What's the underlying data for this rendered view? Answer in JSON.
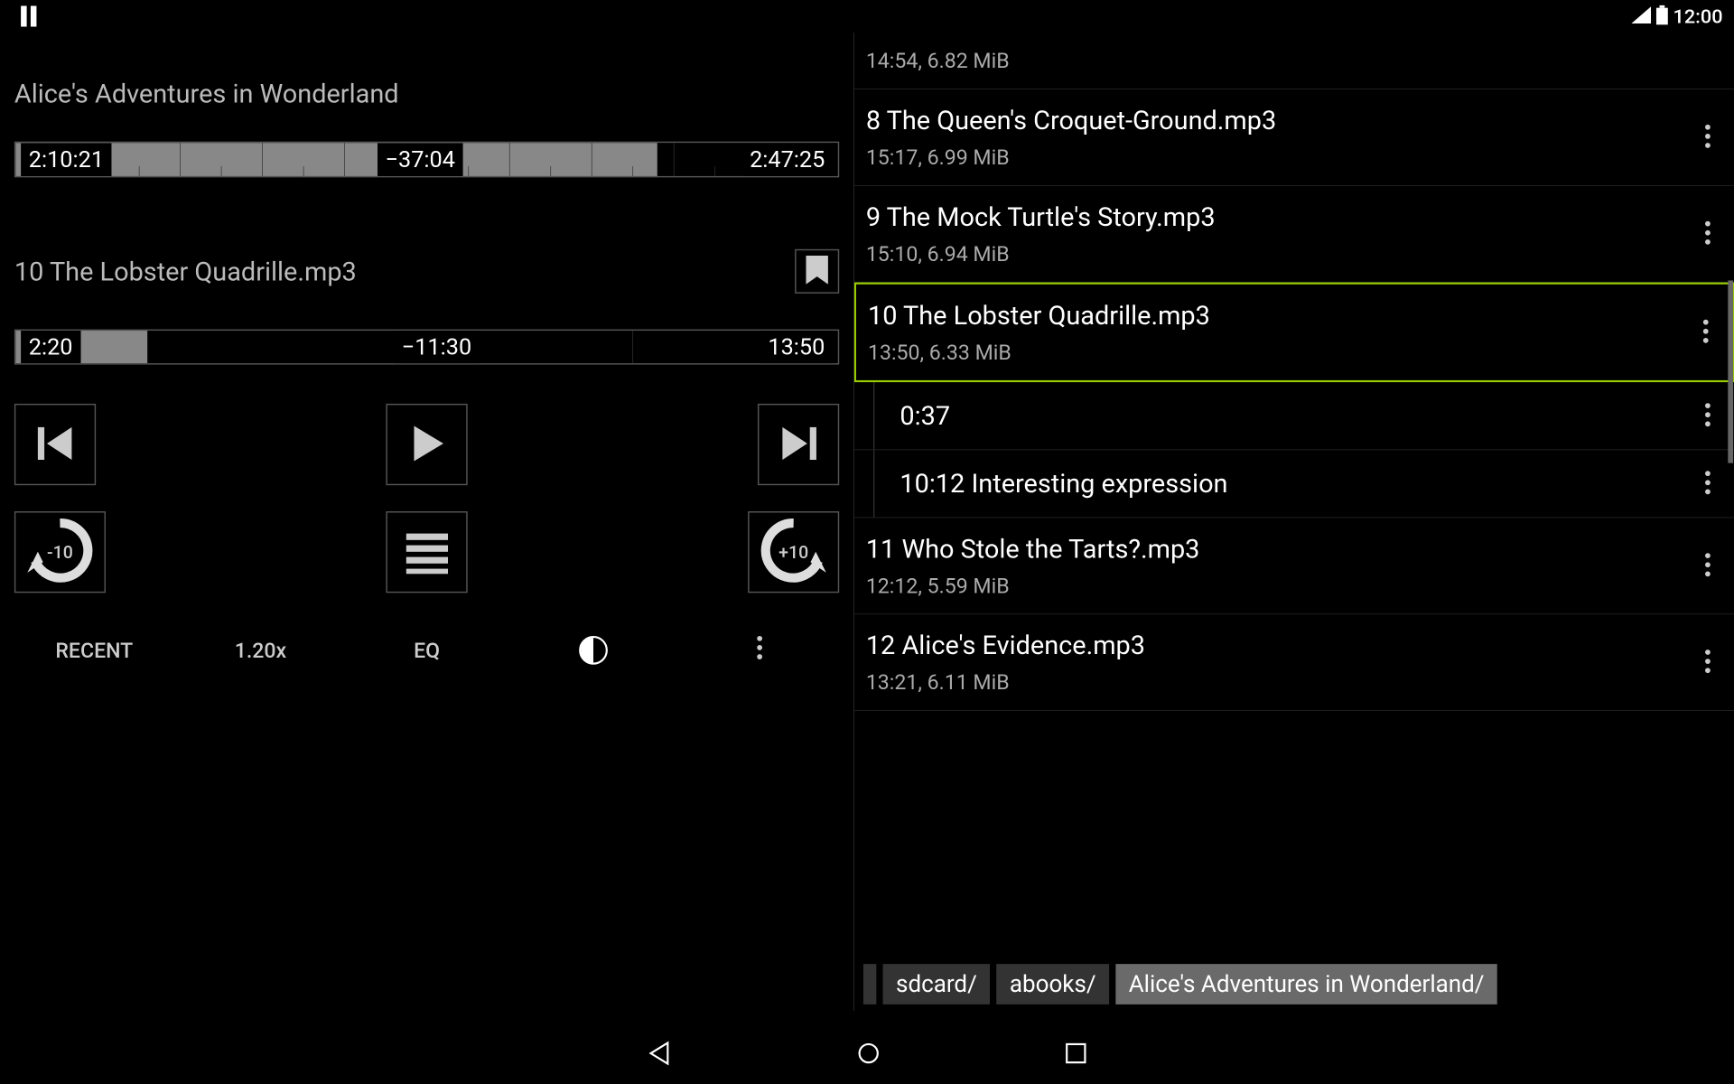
{
  "status": {
    "time": "12:00"
  },
  "book": {
    "title": "Alice's Adventures in Wonderland"
  },
  "overall": {
    "elapsed": "2:10:21",
    "remaining": "−37:04",
    "total": "2:47:25",
    "fill_pct": 78
  },
  "current": {
    "filename": "10 The Lobster Quadrille.mp3",
    "elapsed": "2:20",
    "remaining": "−11:30",
    "total": "13:50",
    "fill_pct": 16
  },
  "skip": {
    "back_label": "-10",
    "fwd_label": "+10"
  },
  "bottom": {
    "recent": "RECENT",
    "speed": "1.20x",
    "eq": "EQ"
  },
  "tracks": [
    {
      "sub_only": "14:54, 6.82 MiB"
    },
    {
      "title": "8 The Queen's Croquet-Ground.mp3",
      "sub": "15:17, 6.99 MiB"
    },
    {
      "title": "9 The Mock Turtle's Story.mp3",
      "sub": "15:10, 6.94 MiB"
    },
    {
      "title": "10 The Lobster Quadrille.mp3",
      "sub": "13:50, 6.33 MiB",
      "highlighted": true
    },
    {
      "title": "11 Who Stole the Tarts?.mp3",
      "sub": "12:12, 5.59 MiB"
    },
    {
      "title": "12 Alice's Evidence.mp3",
      "sub": "13:21, 6.11 MiB"
    }
  ],
  "bookmarks": [
    {
      "text": "0:37"
    },
    {
      "text": "10:12 Interesting expression"
    }
  ],
  "breadcrumb": {
    "items": [
      "sdcard/",
      "abooks/",
      "Alice's Adventures in Wonderland/"
    ]
  }
}
